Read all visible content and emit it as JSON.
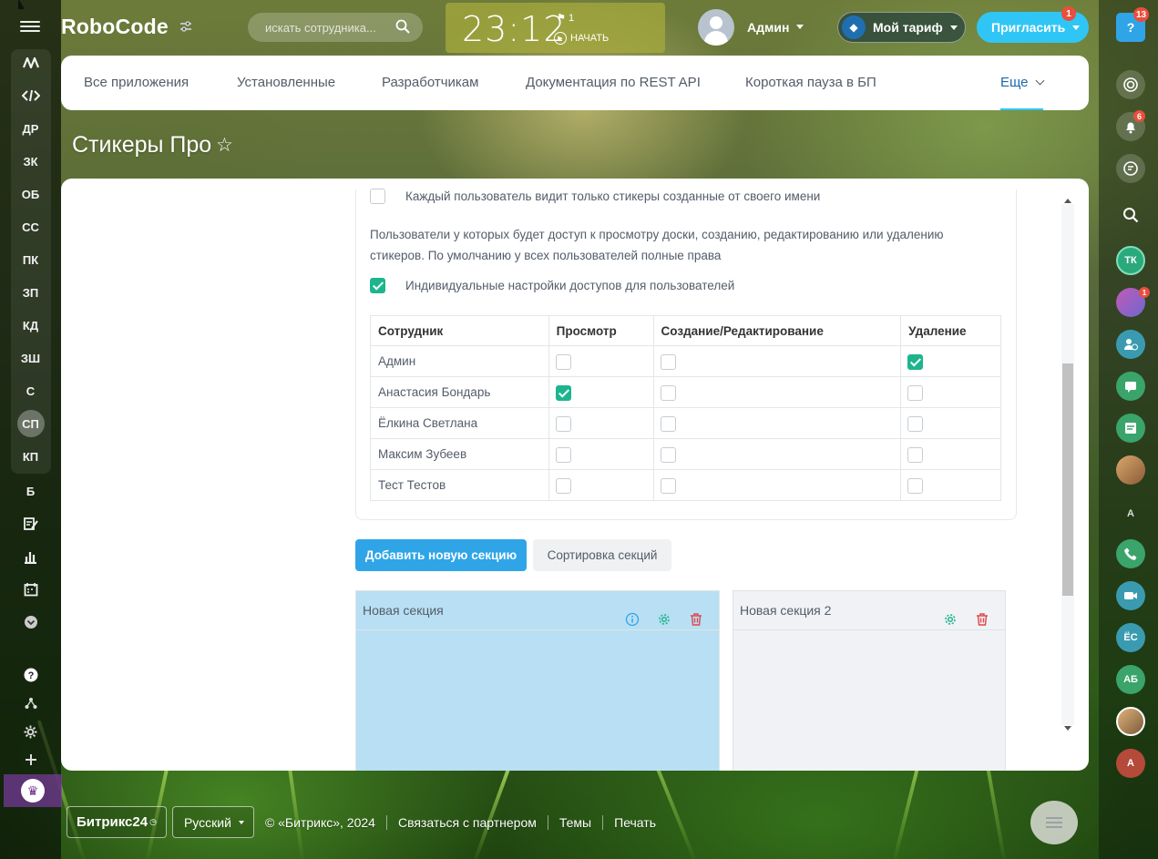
{
  "header": {
    "logo": "RoboCode",
    "search_placeholder": "искать сотрудника...",
    "time": "23:12",
    "flag_count": "1",
    "start_label": "НАЧАТЬ",
    "user_name": "Админ",
    "tariff_label": "Мой тариф",
    "invite_label": "Пригласить",
    "invite_badge": "1"
  },
  "left_menu": {
    "items": [
      "ДР",
      "ЗК",
      "ОБ",
      "СС",
      "ПК",
      "ЗП",
      "КД",
      "ЗШ",
      "С",
      "СП",
      "КП",
      "Б"
    ],
    "active": "СП"
  },
  "tabs": [
    "Все приложения",
    "Установленные",
    "Разработчикам",
    "Документация по REST API",
    "Короткая пауза в БП",
    "Еще"
  ],
  "page_title": "Стикеры Про",
  "settings": {
    "own_only_label": "Каждый пользователь видит только стикеры созданные от своего имени",
    "own_only_checked": false,
    "description": "Пользователи у которых будет доступ к просмотру доски, созданию, редактированию или удалению стикеров. По умолчанию у всех пользователей полные права",
    "individual_label": "Индивидуальные настройки доступов для пользователей",
    "individual_checked": true
  },
  "access_table": {
    "headers": [
      "Сотрудник",
      "Просмотр",
      "Создание/Редактирование",
      "Удаление"
    ],
    "rows": [
      {
        "name": "Админ",
        "view": false,
        "edit": false,
        "delete": true
      },
      {
        "name": "Анастасия Бондарь",
        "view": true,
        "edit": false,
        "delete": false
      },
      {
        "name": "Ёлкина Светлана",
        "view": false,
        "edit": false,
        "delete": false
      },
      {
        "name": "Максим Зубеев",
        "view": false,
        "edit": false,
        "delete": false
      },
      {
        "name": "Тест Тестов",
        "view": false,
        "edit": false,
        "delete": false
      }
    ]
  },
  "buttons": {
    "add_section": "Добавить новую секцию",
    "sort_sections": "Сортировка секций"
  },
  "sections": [
    {
      "title": "Новая секция",
      "color": "#b8dff3"
    },
    {
      "title": "Новая секция 2",
      "color": "#f0f2f5"
    }
  ],
  "footer": {
    "brand": "Битрикс24",
    "language": "Русский",
    "copyright": "© «Битрикс», 2024",
    "links": [
      "Связаться с партнером",
      "Темы",
      "Печать"
    ]
  },
  "right_bar": {
    "help_badge": "13",
    "notifications_badge": "6",
    "avatar_badge": "1",
    "contacts": [
      "ТК",
      "А",
      "ЁС",
      "АБ",
      "А"
    ]
  },
  "colors": {
    "accent": "#2fc6f6",
    "primary_button": "#2fa5e8",
    "checkbox_on": "#1db58e",
    "badge": "#e94f3c"
  }
}
